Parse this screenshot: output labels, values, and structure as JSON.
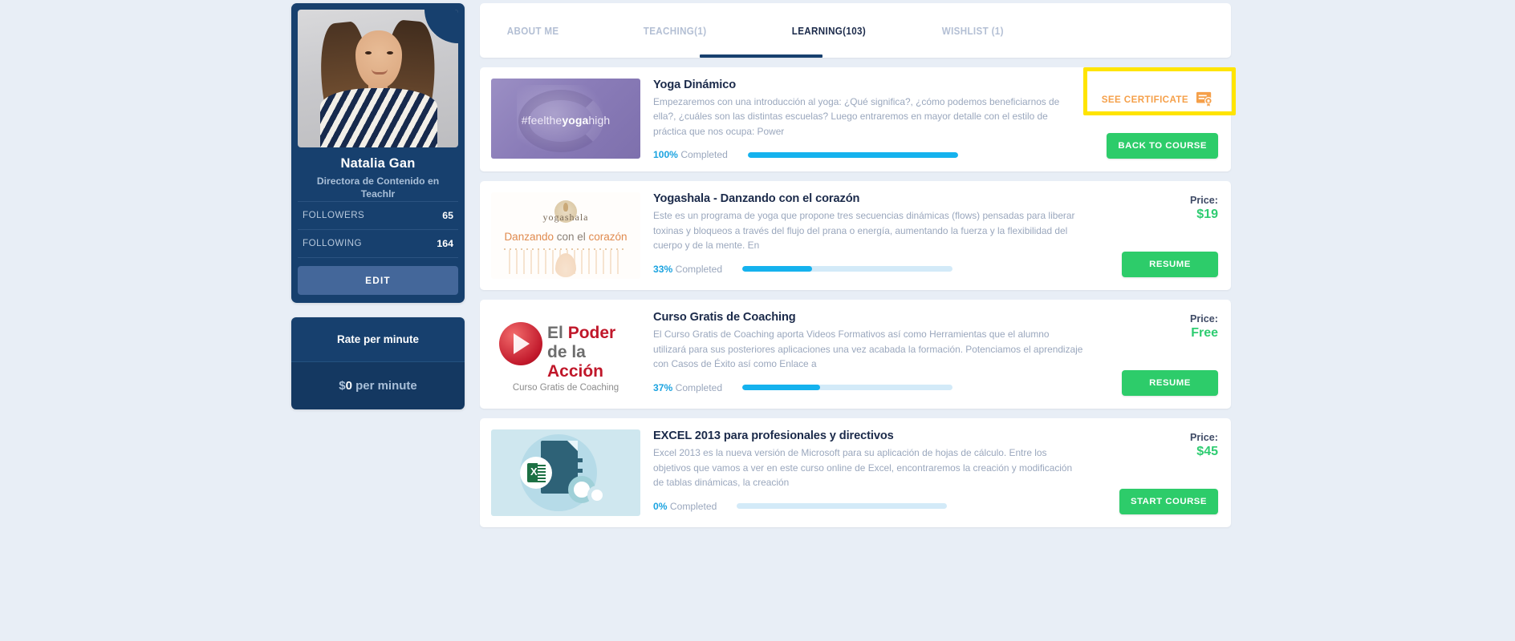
{
  "theme": {
    "page_bg": "#e8eef6",
    "navy": "#17406e",
    "accent_blue": "#15b2ee",
    "green": "#2dcc6a",
    "orange": "#f5a04a",
    "highlight_yellow": "#ffe400"
  },
  "sidebar": {
    "profile": {
      "name": "Natalia Gan",
      "title": "Directora de Contenido en Teachlr",
      "verified_icon": "verified-check-icon",
      "stats": [
        {
          "label": "FOLLOWERS",
          "value": "65"
        },
        {
          "label": "FOLLOWING",
          "value": "164"
        }
      ],
      "edit_label": "EDIT"
    },
    "rate": {
      "heading": "Rate per minute",
      "currency": "$",
      "amount": "0",
      "unit": " per minute"
    }
  },
  "main": {
    "tabs": [
      {
        "label": "ABOUT ME",
        "active": false
      },
      {
        "label": "TEACHING(1)",
        "active": false
      },
      {
        "label": "LEARNING(103)",
        "active": true
      },
      {
        "label": "WISHLIST (1)",
        "active": false
      }
    ],
    "courses": [
      {
        "title": "Yoga Dinámico",
        "description": "Empezaremos con una introducción al yoga: ¿Qué significa?, ¿cómo podemos beneficiarnos de ella?, ¿cuáles son las distintas escuelas? Luego entraremos en mayor detalle con el estilo de práctica que nos ocupa: Power",
        "percent": "100%",
        "completed_label": "Completed",
        "progress": 100,
        "certificate_label": "SEE CERTIFICATE",
        "certificate_icon": "certificate-icon",
        "action_label": "BACK TO COURSE",
        "thumb_text_main": "#feelthe",
        "thumb_text_bold": "yoga",
        "thumb_text_tail": "high",
        "highlighted": true
      },
      {
        "title": "Yogashala - Danzando con el corazón",
        "description": "Este es un programa de yoga que propone tres secuencias dinámicas (flows) pensadas para liberar toxinas y bloqueos a través del flujo del prana o energía, aumentando la fuerza y la flexibilidad del cuerpo y de la mente.  En",
        "percent": "33%",
        "completed_label": "Completed",
        "progress": 33,
        "price_label": "Price:",
        "price_value": "$19",
        "action_label": "RESUME",
        "thumb_brand": "yogashala",
        "thumb_sub_a": "Danzando ",
        "thumb_sub_b": "con el ",
        "thumb_sub_c": "corazón"
      },
      {
        "title": "Curso Gratis de Coaching",
        "description": "El Curso Gratis de Coaching aporta Videos Formativos así como Herramientas que el alumno utilizará para sus posteriores aplicaciones una vez acabada la formación. Potenciamos el aprendizaje con Casos de Éxito así como Enlace a",
        "percent": "37%",
        "completed_label": "Completed",
        "progress": 37,
        "price_label": "Price:",
        "price_value": "Free",
        "action_label": "RESUME",
        "thumb_line1_a": "El ",
        "thumb_line1_b": "Poder",
        "thumb_line2_a": "de la ",
        "thumb_line2_b": "Acción",
        "thumb_caption": "Curso Gratis de Coaching"
      },
      {
        "title": "EXCEL 2013 para profesionales y directivos",
        "description": "Excel 2013 es la nueva versión de Microsoft para su aplicación de hojas de cálculo. Entre los objetivos que vamos a ver en este curso online de Excel, encontraremos la creación y modificación de tablas dinámicas, la creación",
        "percent": "0%",
        "completed_label": "Completed",
        "progress": 0,
        "price_label": "Price:",
        "price_value": "$45",
        "action_label": "START COURSE"
      }
    ]
  }
}
